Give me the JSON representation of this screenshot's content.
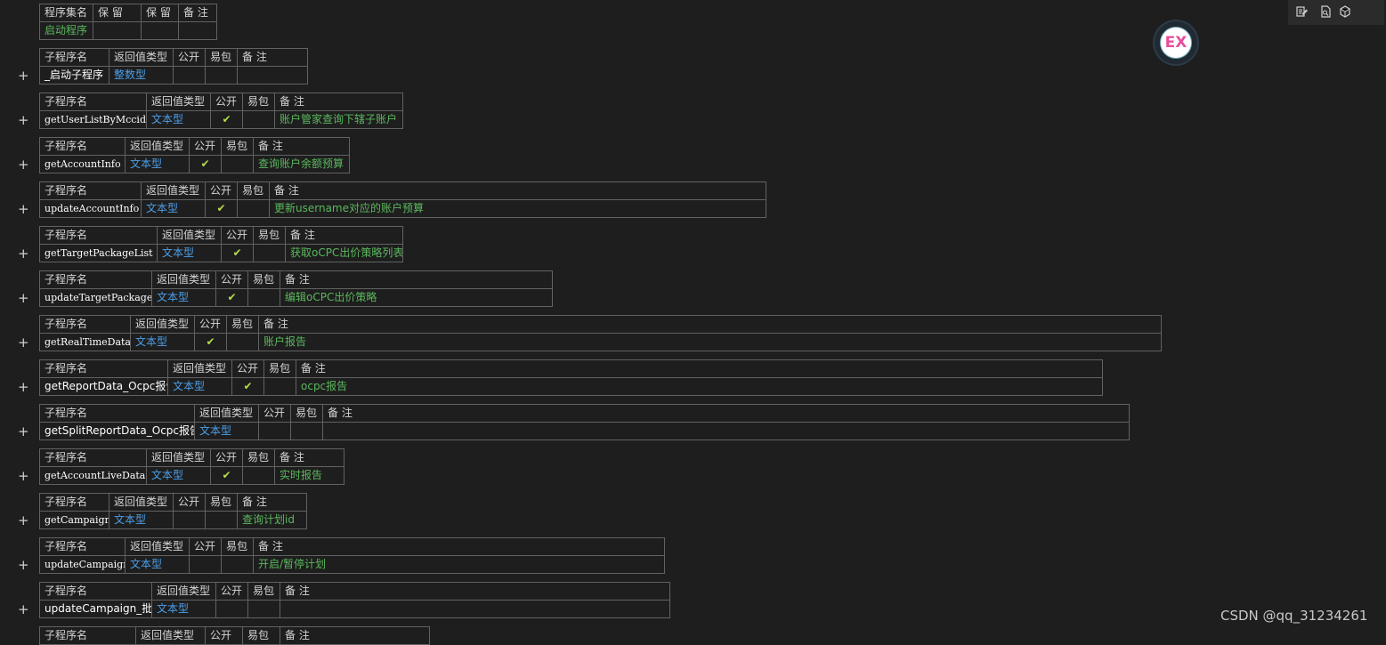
{
  "headers": {
    "assembly": [
      "程序集名",
      "保 留",
      "保 留",
      "备 注"
    ],
    "sub": [
      "子程序名",
      "返回值类型",
      "公开",
      "易包",
      "备 注"
    ]
  },
  "assembly": {
    "name": "启动程序",
    "col2": "",
    "col3": "",
    "remark": ""
  },
  "subs": [
    {
      "name": "_启动子程序",
      "ret": "整数型",
      "public": false,
      "easy": false,
      "remark": ""
    },
    {
      "name": "getUserListByMccid",
      "ret": "文本型",
      "public": true,
      "easy": false,
      "remark": "账户管家查询下辖子账户"
    },
    {
      "name": "getAccountInfo",
      "ret": "文本型",
      "public": true,
      "easy": false,
      "remark": "查询账户余额预算"
    },
    {
      "name": "updateAccountInfo",
      "ret": "文本型",
      "public": true,
      "easy": false,
      "remark": "更新username对应的账户预算"
    },
    {
      "name": "getTargetPackageList",
      "ret": "文本型",
      "public": true,
      "easy": false,
      "remark": "获取oCPC出价策略列表"
    },
    {
      "name": "updateTargetPackage",
      "ret": "文本型",
      "public": true,
      "easy": false,
      "remark": "编辑oCPC出价策略"
    },
    {
      "name": "getRealTimeData",
      "ret": "文本型",
      "public": true,
      "easy": false,
      "remark": "账户报告"
    },
    {
      "name": "getReportData_Ocpc报告",
      "ret": "文本型",
      "public": true,
      "easy": false,
      "remark": "ocpc报告"
    },
    {
      "name": "getSplitReportData_Ocpc报告",
      "ret": "文本型",
      "public": false,
      "easy": false,
      "remark": ""
    },
    {
      "name": "getAccountLiveData",
      "ret": "文本型",
      "public": true,
      "easy": false,
      "remark": "实时报告"
    },
    {
      "name": "getCampaign",
      "ret": "文本型",
      "public": false,
      "easy": false,
      "remark": "查询计划id"
    },
    {
      "name": "updateCampaign",
      "ret": "文本型",
      "public": false,
      "easy": false,
      "remark": "开启/暂停计划"
    },
    {
      "name": "updateCampaign_批量",
      "ret": "文本型",
      "public": false,
      "easy": false,
      "remark": ""
    }
  ],
  "check_mark": "✔",
  "expand_symbol": "+",
  "toolbar": {
    "icons": [
      "edit-icon",
      "document-search-icon",
      "cube-icon"
    ]
  },
  "ex_badge": {
    "label": "EX"
  },
  "watermark": "CSDN @qq_31234261",
  "colors": {
    "background": "#1e1e1e",
    "border": "#626262",
    "type_blue": "#4c9fe8",
    "remark_green": "#5bb85d",
    "check": "#b4dc4a"
  }
}
